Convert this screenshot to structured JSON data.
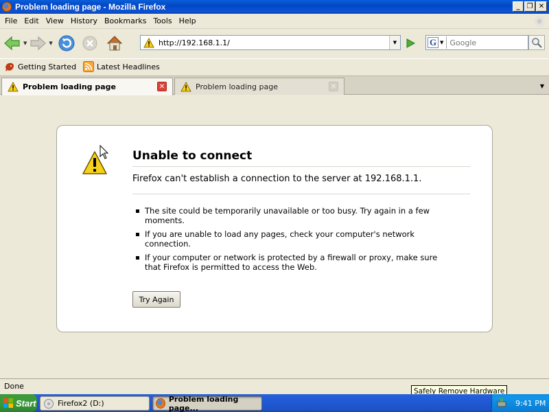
{
  "window": {
    "title": "Problem loading page - Mozilla Firefox",
    "controls": {
      "minimize": "_",
      "restore": "❐",
      "close": "✕"
    }
  },
  "menubar": {
    "items": [
      {
        "label": "File"
      },
      {
        "label": "Edit"
      },
      {
        "label": "View"
      },
      {
        "label": "History"
      },
      {
        "label": "Bookmarks"
      },
      {
        "label": "Tools"
      },
      {
        "label": "Help"
      }
    ]
  },
  "navbar": {
    "url": "http://192.168.1.1/",
    "search_placeholder": "Google"
  },
  "bookmarks": {
    "items": [
      {
        "label": "Getting Started",
        "icon": "firefox-getting-started-icon"
      },
      {
        "label": "Latest Headlines",
        "icon": "rss-feed-icon"
      }
    ]
  },
  "tabs": [
    {
      "label": "Problem loading page",
      "active": true
    },
    {
      "label": "Problem loading page",
      "active": false
    }
  ],
  "error_page": {
    "title": "Unable to connect",
    "description": "Firefox can't establish a connection to the server at 192.168.1.1.",
    "bullets": [
      "The site could be temporarily unavailable or too busy. Try again in a few moments.",
      "If you are unable to load any pages, check your computer's network connection.",
      "If your computer or network is protected by a firewall or proxy, make sure that Firefox is permitted to access the Web."
    ],
    "try_again_label": "Try Again"
  },
  "statusbar": {
    "text": "Done",
    "tooltip": "Safely Remove Hardware"
  },
  "taskbar": {
    "start_label": "Start",
    "tasks": [
      {
        "label": "Firefox2 (D:)",
        "active": false
      },
      {
        "label": "Problem loading page...",
        "active": true
      }
    ],
    "clock": "9:41 PM"
  },
  "colors": {
    "titlebar": "#0346c6",
    "taskbar": "#245edb",
    "start_button": "#3a9a3a",
    "tab_close_active": "#d9423a",
    "warning_yellow": "#f6d11c"
  }
}
